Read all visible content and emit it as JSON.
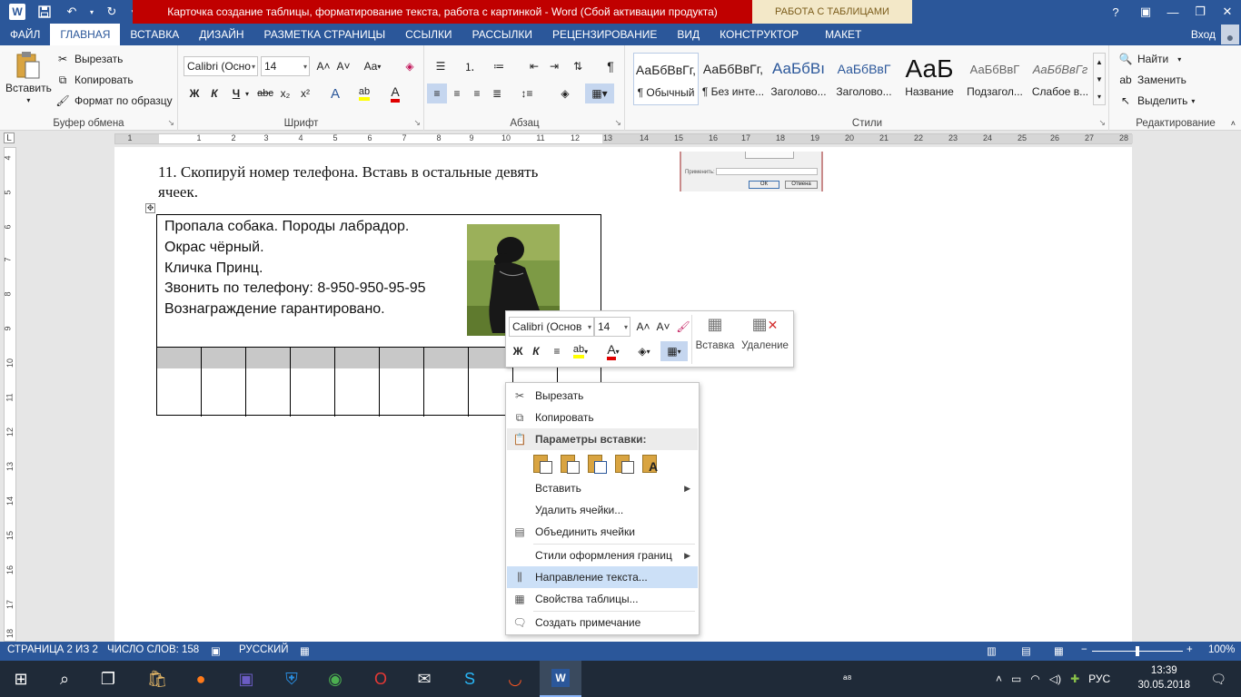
{
  "window": {
    "title": "Карточка создание таблицы, форматирование текста, работа с картинкой -  Word (Сбой активации продукта)",
    "context_tab_group": "РАБОТА С ТАБЛИЦАМИ",
    "help": "?",
    "account": "Вход"
  },
  "tabs": [
    "ФАЙЛ",
    "ГЛАВНАЯ",
    "ВСТАВКА",
    "ДИЗАЙН",
    "РАЗМЕТКА СТРАНИЦЫ",
    "ССЫЛКИ",
    "РАССЫЛКИ",
    "РЕЦЕНЗИРОВАНИЕ",
    "ВИД",
    "КОНСТРУКТОР",
    "МАКЕТ"
  ],
  "ribbon": {
    "clipboard": {
      "paste": "Вставить",
      "cut": "Вырезать",
      "copy": "Копировать",
      "format_painter": "Формат по образцу",
      "label": "Буфер обмена"
    },
    "font": {
      "name": "Calibri (Осно",
      "size": "14",
      "bold": "Ж",
      "italic": "К",
      "underline": "Ч",
      "strike": "abc",
      "subscript": "x₂",
      "superscript": "x²",
      "grow": "A˄",
      "shrink": "A˅",
      "case": "Aa",
      "label": "Шрифт"
    },
    "paragraph": {
      "label": "Абзац"
    },
    "styles": {
      "items": [
        {
          "sample": "АаБбВвГг,",
          "name": "¶ Обычный"
        },
        {
          "sample": "АаБбВвГг,",
          "name": "¶ Без инте..."
        },
        {
          "sample": "АаБбВı",
          "name": "Заголово..."
        },
        {
          "sample": "АаБбВвГ",
          "name": "Заголово..."
        },
        {
          "sample": "АаБ",
          "name": "Название"
        },
        {
          "sample": "АаБбВвГ",
          "name": "Подзагол..."
        },
        {
          "sample": "АаБбВвГг",
          "name": "Слабое в..."
        }
      ],
      "label": "Стили"
    },
    "editing": {
      "find": "Найти",
      "replace": "Заменить",
      "select": "Выделить",
      "label": "Редактирование"
    }
  },
  "ruler": {
    "h_numbers": [
      "1",
      "1",
      "2",
      "3",
      "4",
      "5",
      "6",
      "7",
      "8",
      "9",
      "10",
      "11",
      "12",
      "13",
      "14",
      "15",
      "16",
      "17",
      "18",
      "19",
      "20",
      "21",
      "22",
      "23",
      "24",
      "25",
      "26",
      "27",
      "28"
    ],
    "v_numbers": [
      "4",
      "5",
      "6",
      "7",
      "8",
      "9",
      "10",
      "11",
      "12",
      "13",
      "14",
      "15",
      "16",
      "17",
      "18"
    ]
  },
  "document": {
    "line1": "11. Скопируй номер телефона. Вставь в остальные девять",
    "line2": "ячеек.",
    "ad_lines": [
      "Пропала собака. Породы лабрадор.",
      "Окрас чёрный.",
      "Кличка Принц.",
      "Звонить по телефону: 8-950-950-95-95",
      "Вознаграждение гарантировано."
    ],
    "thumb": {
      "label": "Применить:",
      "ok": "ОК",
      "cancel": "Отмена"
    }
  },
  "mini_toolbar": {
    "font": "Calibri (Основ",
    "size": "14",
    "bold": "Ж",
    "italic": "К",
    "insert": "Вставка",
    "delete": "Удаление"
  },
  "context_menu": {
    "cut": "Вырезать",
    "copy": "Копировать",
    "paste_header": "Параметры вставки:",
    "insert": "Вставить",
    "delete_cells": "Удалить ячейки...",
    "merge_cells": "Объединить ячейки",
    "border_styles": "Стили оформления границ",
    "text_direction": "Направление текста...",
    "table_properties": "Свойства таблицы...",
    "new_comment": "Создать примечание"
  },
  "statusbar": {
    "page": "СТРАНИЦА 2 ИЗ 2",
    "words": "ЧИСЛО СЛОВ: 158",
    "language": "РУССКИЙ",
    "zoom": "100%"
  },
  "taskbar": {
    "lang": "РУС",
    "time": "13:39",
    "date": "30.05.2018"
  },
  "colors": {
    "word_blue": "#2b579a",
    "title_red": "#c00000",
    "context_tab": "#f3e8c8",
    "highlight": "#cce0f7"
  }
}
